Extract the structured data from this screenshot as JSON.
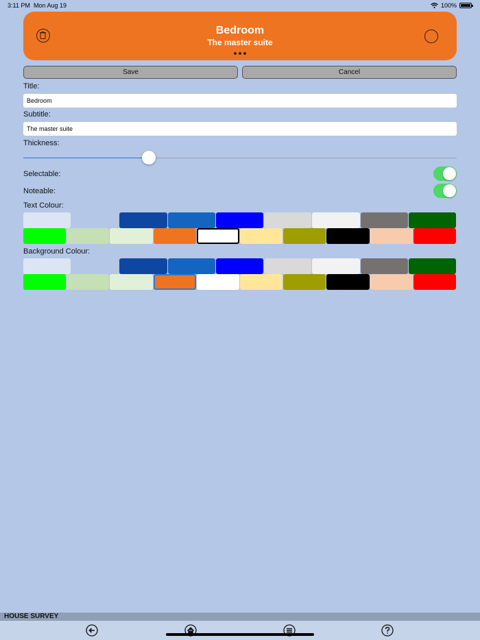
{
  "status": {
    "time": "3:11 PM",
    "date": "Mon Aug 19",
    "battery": "100%"
  },
  "header": {
    "title": "Bedroom",
    "subtitle": "The master suite"
  },
  "actions": {
    "save": "Save",
    "cancel": "Cancel"
  },
  "form": {
    "title_label": "Title:",
    "title_value": "Bedroom",
    "subtitle_label": "Subtitle:",
    "subtitle_value": "The master suite",
    "thickness_label": "Thickness:",
    "thickness_value": 0.29,
    "selectable_label": "Selectable:",
    "selectable_on": true,
    "noteable_label": "Noteable:",
    "noteable_on": true,
    "text_colour_label": "Text Colour:",
    "background_colour_label": "Background Colour:"
  },
  "palette_row1": [
    "#dce5f4",
    "#b4c7e7",
    "#0d47a1",
    "#1565c0",
    "#0000ff",
    "#d9d9d9",
    "#f2f2f2",
    "#767171",
    "#006400"
  ],
  "palette_row2": [
    "#00ff00",
    "#c5e0b4",
    "#e2f0d9",
    "#ef7421",
    "#ffffff",
    "#ffe699",
    "#9e9e00",
    "#000000",
    "#f8cbad",
    "#ff0000"
  ],
  "text_colour_selected": "#ffffff",
  "background_colour_selected": "#ef7421",
  "footer": {
    "app_name": "HOUSE SURVEY"
  },
  "tabbar": {
    "icons": [
      "back-icon",
      "home-icon",
      "list-icon",
      "help-icon"
    ]
  },
  "colors": {
    "accent": "#ef7421",
    "background": "#b4c7e7",
    "toggle_on": "#4cd964"
  }
}
